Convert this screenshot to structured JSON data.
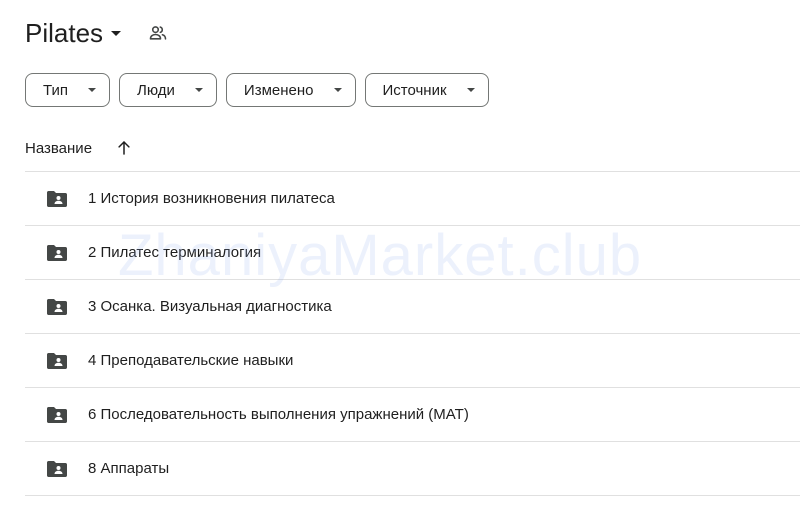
{
  "folder": {
    "title": "Pilates"
  },
  "filters": [
    {
      "label": "Тип"
    },
    {
      "label": "Люди"
    },
    {
      "label": "Изменено"
    },
    {
      "label": "Источник"
    }
  ],
  "list_header": {
    "name_label": "Название"
  },
  "items": [
    {
      "label": "1 История возникновения пилатеса"
    },
    {
      "label": "2 Пилатес терминалогия"
    },
    {
      "label": "3 Осанка. Визуальная диагностика"
    },
    {
      "label": "4 Преподавательские навыки"
    },
    {
      "label": "6 Последовательность выполнения упражнений (MAT)"
    },
    {
      "label": "8 Аппараты"
    }
  ],
  "watermark": "ZhaniyaMarket.club",
  "icons": {
    "share": "shared-people-icon",
    "sort": "arrow-up-icon",
    "folder": "shared-folder-icon"
  },
  "colors": {
    "text": "#1f1f1f",
    "icon": "#444746",
    "chip_border": "#747775",
    "divider": "#e0e0e0"
  }
}
